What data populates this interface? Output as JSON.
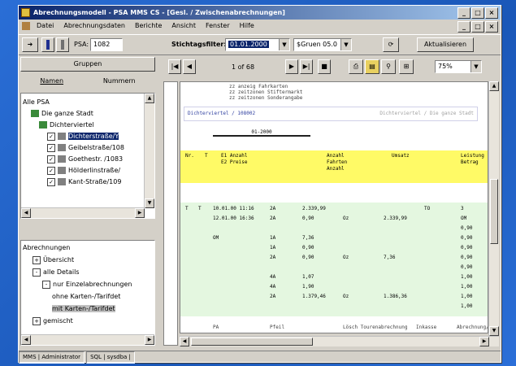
{
  "window": {
    "title": "Abrechnungsmodell - PSA MMS CS - [Gesl. / Zwischenabrechnungen]",
    "controls": [
      "_",
      "□",
      "×"
    ]
  },
  "menu": [
    "Datei",
    "Abrechnungsdaten",
    "Berichte",
    "Ansicht",
    "Fenster",
    "Hilfe"
  ],
  "toolbar": {
    "psa_label": "PSA:",
    "psa_value": "1082",
    "date_label": "Stichtagsfilter:",
    "date_value": "01.01.2000",
    "unit_value": "$Gruen 05.0",
    "refresh_label": "Aktualisieren"
  },
  "left_panel": {
    "header": "Gruppen",
    "tabs": [
      "Namen",
      "Nummern"
    ],
    "tree1": [
      {
        "label": "Alle PSA",
        "indent": 0,
        "type": "root"
      },
      {
        "label": "Die ganze Stadt",
        "indent": 1,
        "type": "folder"
      },
      {
        "label": "Dichterviertel",
        "indent": 2,
        "type": "folder"
      },
      {
        "label": "Dichterstraße/Y",
        "indent": 3,
        "type": "check",
        "selected": true
      },
      {
        "label": "Geibelstraße/108",
        "indent": 3,
        "type": "check"
      },
      {
        "label": "Goethestr. /1083",
        "indent": 3,
        "type": "check"
      },
      {
        "label": "Hölderlinstraße/",
        "indent": 3,
        "type": "check"
      },
      {
        "label": "Kant-Straße/109",
        "indent": 3,
        "type": "check"
      }
    ],
    "tree2": [
      {
        "label": "Abrechnungen",
        "indent": 0
      },
      {
        "label": "Übersicht",
        "indent": 1,
        "expander": "+"
      },
      {
        "label": "alle Details",
        "indent": 1,
        "expander": "-"
      },
      {
        "label": "nur Einzelabrechnungen",
        "indent": 2,
        "expander": "-"
      },
      {
        "label": "ohne Karten-/Tarifdet",
        "indent": 3
      },
      {
        "label": "mit Karten-/Tarifdet",
        "indent": 3,
        "selected": true
      },
      {
        "label": "gemischt",
        "indent": 1,
        "expander": "+"
      }
    ]
  },
  "report_nav": {
    "page_text": "1 of 68",
    "zoom": "75%"
  },
  "report": {
    "top_lines": [
      "zz anzeig Fahrkarten",
      "zz zeitzonen Stiftermarkt",
      "zz zeitzonen Sonderangabe"
    ],
    "section_title": "Dichterviertel / 108002",
    "section_right": "Dichterviertel / Die ganze Stadt",
    "subtitle": "01-2000",
    "yellow_header": [
      "Nr.",
      "T",
      "E1 Anzahl",
      "Anzahl",
      "Umsatz",
      "Leistung"
    ],
    "yellow_sub": [
      "",
      "",
      "E2 Preise",
      "Fahrten",
      "",
      "Betrag"
    ],
    "yellow_sub2": [
      "",
      "",
      "",
      "Anzahl",
      "",
      ""
    ],
    "green_rows": [
      [
        "T",
        "T",
        "10.01.00 11:16",
        "2A",
        "2.339,99",
        "",
        "",
        "TO",
        "3"
      ],
      [
        "",
        "",
        "12.01.00 16:36",
        "2A",
        "0,90",
        "Oz",
        "2.339,99",
        "",
        "OM"
      ],
      [
        "",
        "",
        "",
        "",
        "",
        "",
        "",
        "",
        "0,90"
      ],
      [
        "",
        "",
        "OM",
        "1A",
        "7,36",
        "",
        "",
        "",
        "0,90"
      ],
      [
        "",
        "",
        "",
        "1A",
        "0,90",
        "",
        "",
        "",
        "0,90"
      ],
      [
        "",
        "",
        "",
        "2A",
        "0,90",
        "Oz",
        "7,36",
        "",
        "0,90"
      ],
      [
        "",
        "",
        "",
        "",
        "",
        "",
        "",
        "",
        "0,90"
      ],
      [
        "",
        "",
        "",
        "4A",
        "1,07",
        "",
        "",
        "",
        "1,00"
      ],
      [
        "",
        "",
        "",
        "4A",
        "1,90",
        "",
        "",
        "",
        "1,00"
      ],
      [
        "",
        "",
        "",
        "2A",
        "1.379,46",
        "Oz",
        "1.386,36",
        "",
        "1,00"
      ],
      [
        "",
        "",
        "",
        "",
        "",
        "",
        "",
        "",
        "1,00"
      ]
    ],
    "footer_line": [
      "PA",
      "Pfeil",
      "Lösch Tourenabrechnung",
      "Inkasse",
      "Abrechnung/Pfad"
    ]
  },
  "status": [
    "MMS | Administrator",
    "SQL | sysdba |"
  ]
}
